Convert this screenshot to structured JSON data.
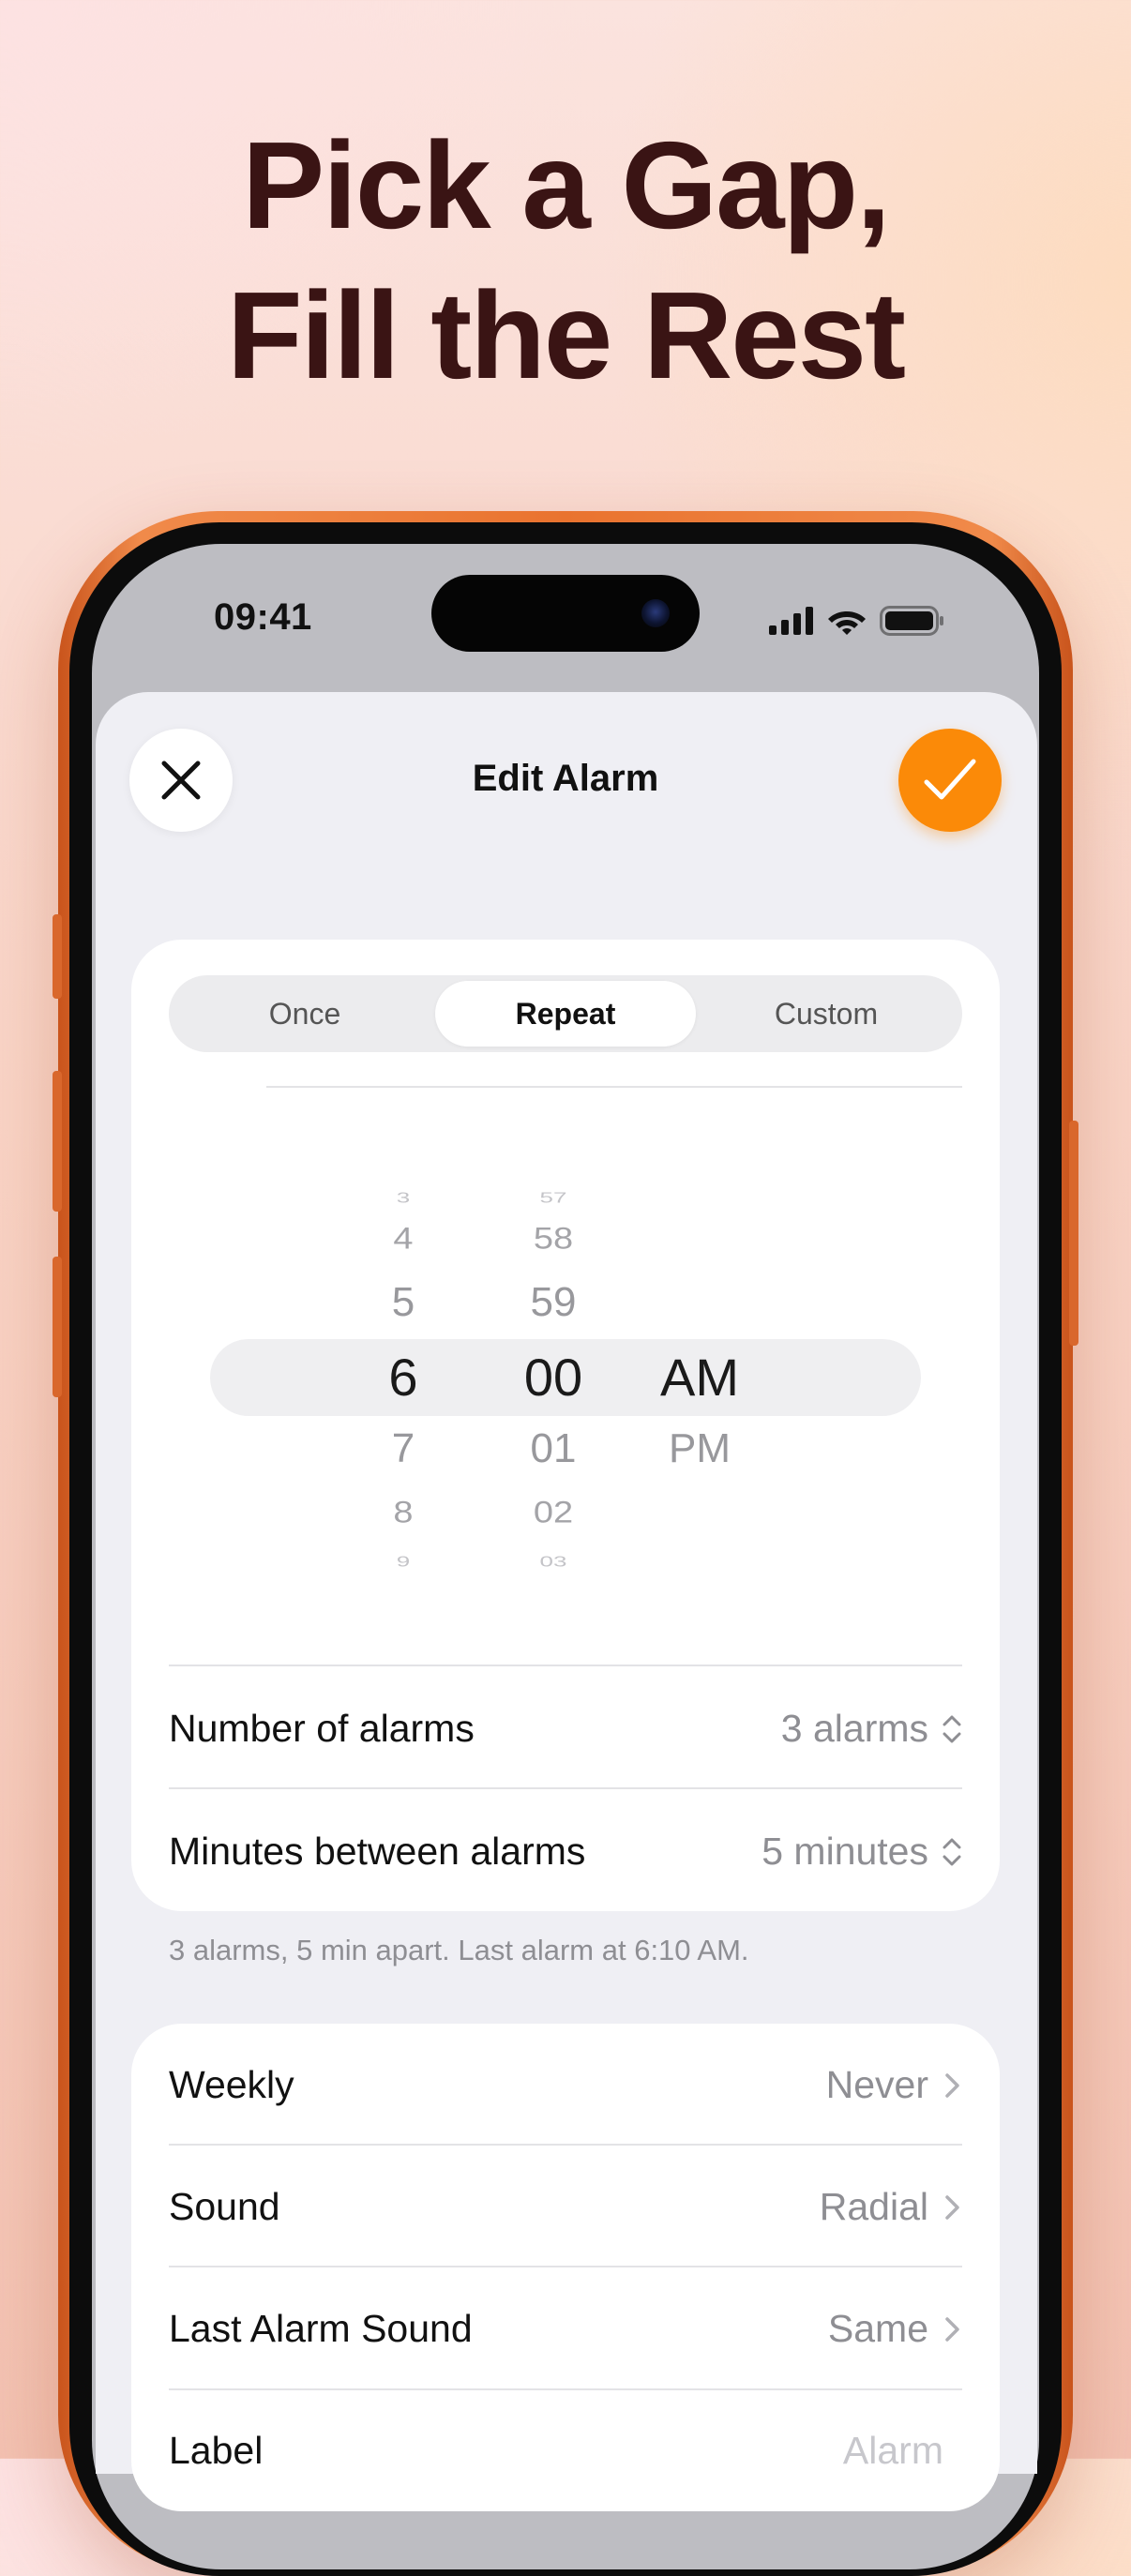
{
  "headline": {
    "line1": "Pick a Gap,",
    "line2": "Fill the Rest"
  },
  "status_bar": {
    "time": "09:41",
    "icons": [
      "cellular-signal-icon",
      "wifi-icon",
      "battery-icon"
    ]
  },
  "header": {
    "title": "Edit Alarm",
    "close_icon": "close-icon",
    "confirm_icon": "checkmark-icon"
  },
  "colors": {
    "accent": "#fb8a08",
    "phone_frame": "#e9732f",
    "headline": "#3a1414"
  },
  "mode_tabs": [
    {
      "label": "Once",
      "selected": false
    },
    {
      "label": "Repeat",
      "selected": true
    },
    {
      "label": "Custom",
      "selected": false
    }
  ],
  "time_picker": {
    "hours": [
      "3",
      "4",
      "5",
      "6",
      "7",
      "8",
      "9"
    ],
    "minutes": [
      "57",
      "58",
      "59",
      "00",
      "01",
      "02",
      "03"
    ],
    "periods": [
      "AM",
      "PM"
    ],
    "selected": {
      "hour": "6",
      "minute": "00",
      "period": "AM"
    }
  },
  "settings_group_1": {
    "rows": [
      {
        "label": "Number of alarms",
        "value": "3 alarms",
        "control": "stepper"
      },
      {
        "label": "Minutes between alarms",
        "value": "5 minutes",
        "control": "stepper"
      }
    ],
    "caption": "3 alarms, 5 min apart. Last alarm at 6:10 AM."
  },
  "settings_group_2": {
    "rows": [
      {
        "label": "Weekly",
        "value": "Never"
      },
      {
        "label": "Sound",
        "value": "Radial"
      },
      {
        "label": "Last Alarm Sound",
        "value": "Same"
      },
      {
        "label": "Label",
        "value": "Alarm"
      }
    ]
  }
}
